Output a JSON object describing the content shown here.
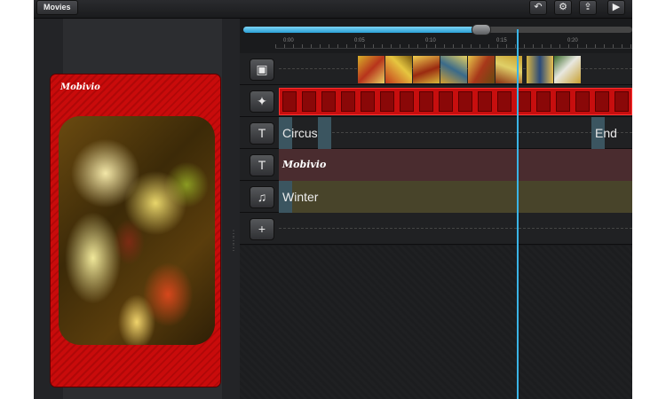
{
  "topbar": {
    "movies_label": "Movies",
    "tools": [
      {
        "icon": "undo-icon",
        "glyph": "↶"
      },
      {
        "icon": "gear-icon",
        "glyph": "⚙"
      },
      {
        "icon": "share-icon",
        "glyph": "⇪"
      },
      {
        "icon": "play-icon",
        "glyph": "▶"
      }
    ]
  },
  "preview": {
    "title": "Mobivio"
  },
  "timeline": {
    "ruler_ticks": [
      "0:00",
      "0:05",
      "0:10",
      "0:15",
      "0:20"
    ],
    "progress": 0.6,
    "tracks": [
      {
        "type": "photo",
        "icon": "image-icon",
        "glyph": "▣"
      },
      {
        "type": "effect",
        "icon": "magic-wand-icon",
        "glyph": "✦"
      },
      {
        "type": "text",
        "icon": "text-icon",
        "glyph": "T",
        "clips": [
          "Circus",
          "End"
        ]
      },
      {
        "type": "title",
        "icon": "text-icon",
        "glyph": "T",
        "label": "Mobivio"
      },
      {
        "type": "music",
        "icon": "music-note-icon",
        "glyph": "♫",
        "label": "Winter"
      },
      {
        "type": "add",
        "icon": "plus-icon",
        "glyph": "+"
      }
    ]
  },
  "colors": {
    "accent": "#2a9fd6",
    "card_red": "#c90b0b",
    "playhead": "#3ab4e6"
  }
}
